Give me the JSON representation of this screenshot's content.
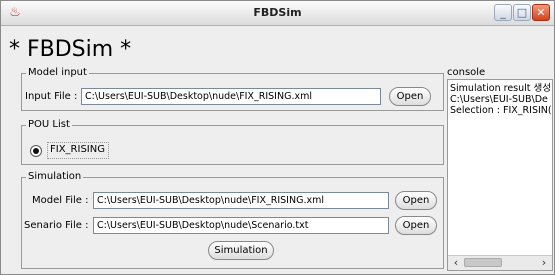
{
  "window": {
    "title": "FBDSim"
  },
  "heading": "* FBDSim *",
  "model_input": {
    "legend": "Model input",
    "input_label": "Input File :",
    "input_value": "C:\\Users\\EUI-SUB\\Desktop\\nude\\FIX_RISING.xml",
    "open_label": "Open"
  },
  "pou_list": {
    "legend": "POU List",
    "items": [
      {
        "label": "FIX_RISING",
        "selected": true
      }
    ]
  },
  "simulation": {
    "legend": "Simulation",
    "model_label": "Model File :",
    "model_value": "C:\\Users\\EUI-SUB\\Desktop\\nude\\FIX_RISING.xml",
    "model_open": "Open",
    "senario_label": "Senario File :",
    "senario_value": "C:\\Users\\EUI-SUB\\Desktop\\nude\\Scenario.txt",
    "senario_open": "Open",
    "run_label": "Simulation"
  },
  "console": {
    "title": "console",
    "lines": [
      "Simulation result 생성",
      "C:\\Users\\EUI-SUB\\De",
      "Selection : FIX_RISIN("
    ]
  }
}
